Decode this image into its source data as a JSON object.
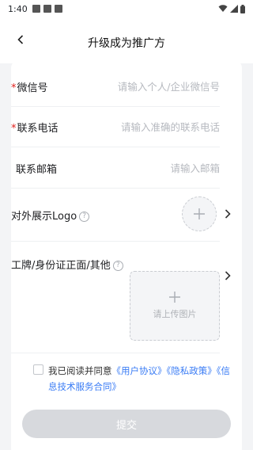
{
  "status_bar": {
    "time": "1:40"
  },
  "nav": {
    "title": "升级成为推广方"
  },
  "form": {
    "wechat": {
      "label": "微信号",
      "required": "*",
      "placeholder": "请输入个人/企业微信号"
    },
    "phone": {
      "label": "联系电话",
      "required": "*",
      "placeholder": "请输入准确的联系电话"
    },
    "email": {
      "label": "联系邮箱",
      "placeholder": "请输入邮箱"
    },
    "logo": {
      "label": "对外展示Logo"
    },
    "id_photo": {
      "label": "工牌/身份证正面/其他",
      "upload_text": "请上传图片"
    }
  },
  "agreement": {
    "prefix": "我已阅读并同意",
    "user_agreement": "《用户协议》",
    "privacy_policy": "《隐私政策》",
    "service_contract": "《信息技术服务合同》"
  },
  "submit": {
    "label": "提交"
  },
  "colors": {
    "required": "#e0201c",
    "link": "#3a7cf5",
    "disabled_button": "#d7d9dd"
  }
}
